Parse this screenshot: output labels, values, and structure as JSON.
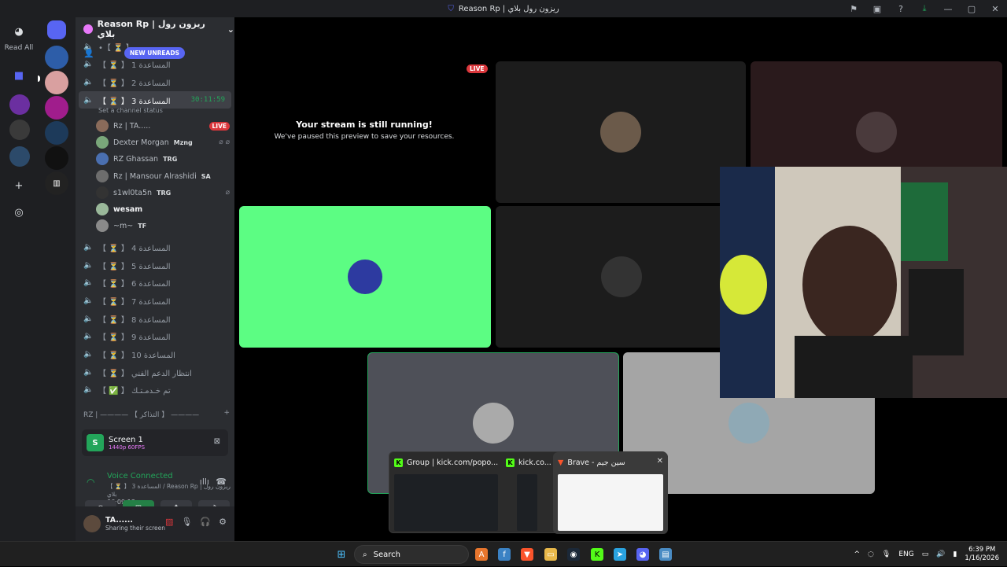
{
  "window": {
    "title": "Reason Rp | ريزون رول بلاي"
  },
  "left_strip": {
    "read_all": "Read All"
  },
  "server": {
    "name": "Reason Rp | ريزون رول بلاي",
    "new_unreads": "NEW UNREADS"
  },
  "channels": [
    {
      "label": "【 ⏳ 】 1 المساعدة",
      "active": false
    },
    {
      "label": "【 ⏳ 】 2 المساعدة",
      "active": false
    },
    {
      "label": "【 ⏳ 】 3 المساعدة",
      "active": true,
      "timer": "30:11:59",
      "status_hint": "Set a channel status"
    },
    {
      "label": "【 ⏳ 】 4 المساعدة"
    },
    {
      "label": "【 ⏳ 】 5 المساعدة"
    },
    {
      "label": "【 ⏳ 】 6 المساعدة"
    },
    {
      "label": "【 ⏳ 】 7 المساعدة"
    },
    {
      "label": "【 ⏳ 】 8 المساعدة"
    },
    {
      "label": "【 ⏳ 】 9 المساعدة"
    },
    {
      "label": "【 ⏳ 】 10 المساعدة"
    },
    {
      "label": "【 ⏳ 】 انتظار الدعم الفني"
    },
    {
      "label": "【 ✅ 】 تم خـدمـتـك"
    }
  ],
  "voice_users": [
    {
      "name": "Rz | TA.....",
      "tag": "",
      "badge": "LIVE",
      "color": "#8a6b5a"
    },
    {
      "name": "Dexter Morgan",
      "tag": "Mzng",
      "icons": "⌀ ⌀",
      "color": "#7aa77a"
    },
    {
      "name": "RZ Ghassan",
      "tag": "TRG",
      "color": "#4a6fb0"
    },
    {
      "name": "Rz | Mansour Alrashidi",
      "tag": "SA",
      "color": "#6d6d6d"
    },
    {
      "name": "s1wl0ta5n",
      "tag": "TRG",
      "icons": "⌀",
      "color": "#333333"
    },
    {
      "name": "wesam",
      "tag": "",
      "color": "#9ab89a"
    },
    {
      "name": "~m~",
      "tag": "TF",
      "color": "#8a8a8a"
    }
  ],
  "category": {
    "label": "RZ | ———— 【 التذاكر 】 ————"
  },
  "screen_share": {
    "title": "Screen 1",
    "quality": "1440p 60FPS"
  },
  "voice": {
    "status": "Voice Connected",
    "channel": "【 ⏳ 】 3 المساعدة / Reason Rp | ريزون رول بلاي",
    "elapsed": "06:09:13"
  },
  "user_panel": {
    "name": "TA......",
    "status": "Sharing their screen"
  },
  "stage": {
    "paused_title": "Your stream is still running!",
    "paused_sub": "We've paused this preview to save your resources.",
    "live": "LIVE"
  },
  "preview": {
    "items": [
      {
        "title": "Group | kick.com/popo..."
      },
      {
        "title": "kick.co..."
      },
      {
        "title": "Brave - سين جيم"
      }
    ]
  },
  "taskbar": {
    "search": "Search",
    "lang": "ENG",
    "time": "6:39 PM",
    "date": "1/16/2026"
  }
}
